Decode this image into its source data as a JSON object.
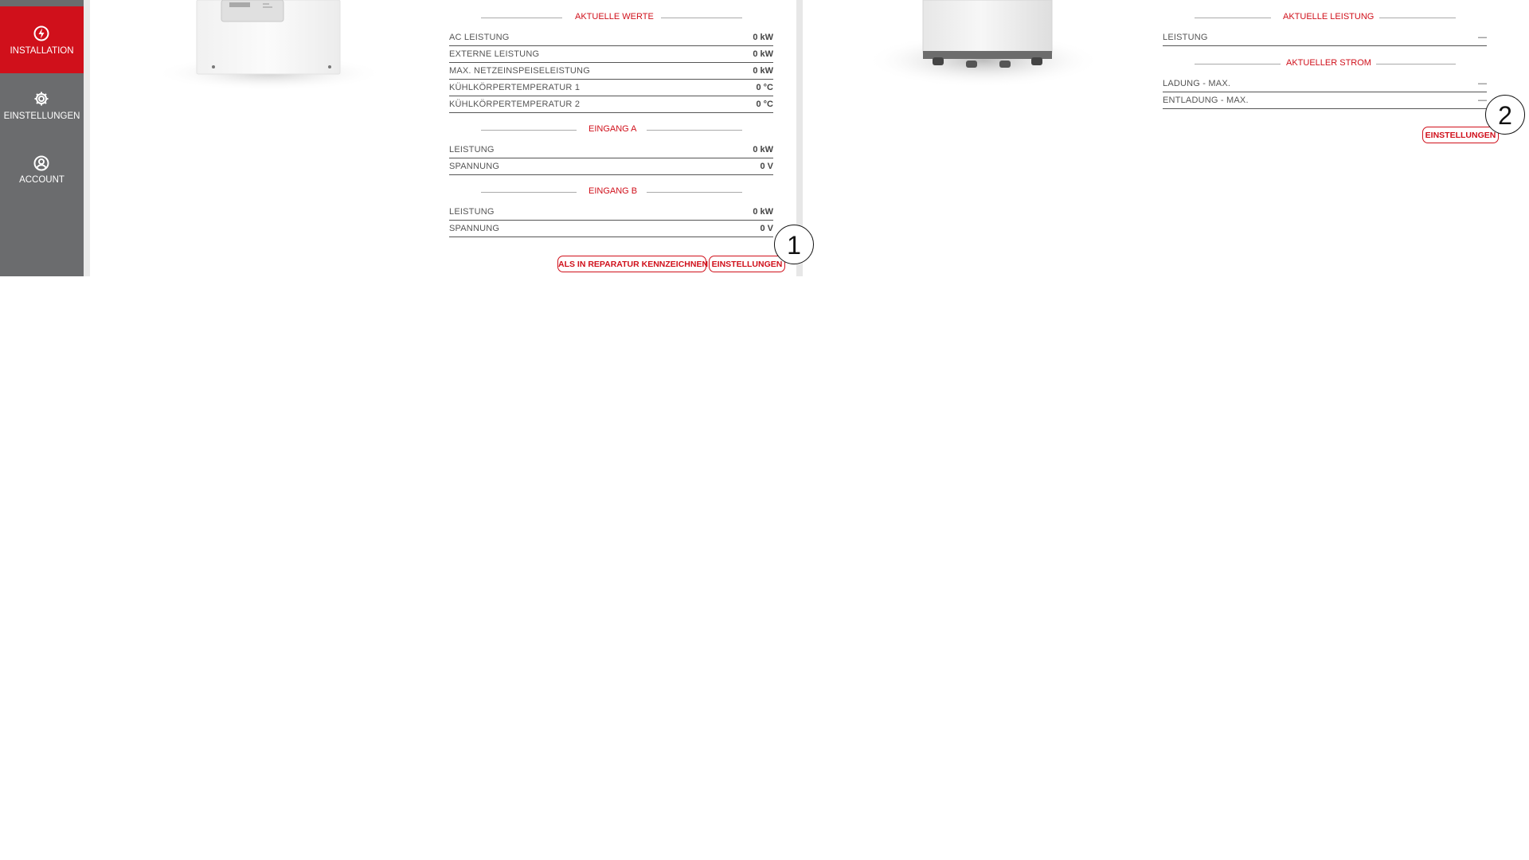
{
  "sidebar": {
    "items": [
      {
        "label": "INSTALLATION",
        "icon": "lightning-icon",
        "active": true
      },
      {
        "label": "EINSTELLUNGEN",
        "icon": "gear-icon",
        "active": false
      },
      {
        "label": "ACCOUNT",
        "icon": "user-circle-icon",
        "active": false
      }
    ]
  },
  "inverter": {
    "current_values_title": "AKTUELLE WERTE",
    "current_values": [
      {
        "label": "AC LEISTUNG",
        "value": "0 kW"
      },
      {
        "label": "EXTERNE LEISTUNG",
        "value": "0 kW"
      },
      {
        "label": "MAX. NETZEINSPEISELEISTUNG",
        "value": "0 kW"
      },
      {
        "label": "KÜHLKÖRPERTEMPERATUR 1",
        "value": "0 °C"
      },
      {
        "label": "KÜHLKÖRPERTEMPERATUR 2",
        "value": "0 °C"
      }
    ],
    "input_a_title": "EINGANG A",
    "input_a": [
      {
        "label": "LEISTUNG",
        "value": "0 kW"
      },
      {
        "label": "SPANNUNG",
        "value": "0 V"
      }
    ],
    "input_b_title": "EINGANG B",
    "input_b": [
      {
        "label": "LEISTUNG",
        "value": "0 kW"
      },
      {
        "label": "SPANNUNG",
        "value": "0 V"
      }
    ],
    "repair_button": "ALS IN REPARATUR KENNZEICHNEN",
    "settings_button": "EINSTELLUNGEN"
  },
  "battery": {
    "current_power_title": "AKTUELLE LEISTUNG",
    "current_power": [
      {
        "label": "LEISTUNG",
        "value": "—"
      }
    ],
    "current_title": "AKTUELLER STROM",
    "current": [
      {
        "label": "LADUNG - MAX.",
        "value": "—"
      },
      {
        "label": "ENTLADUNG - MAX.",
        "value": "—"
      }
    ],
    "settings_button": "EINSTELLUNGEN"
  },
  "callouts": [
    "1",
    "2"
  ],
  "colors": {
    "accent": "#d0101b",
    "sidebar": "#6b6c6e",
    "text": "#555555"
  }
}
